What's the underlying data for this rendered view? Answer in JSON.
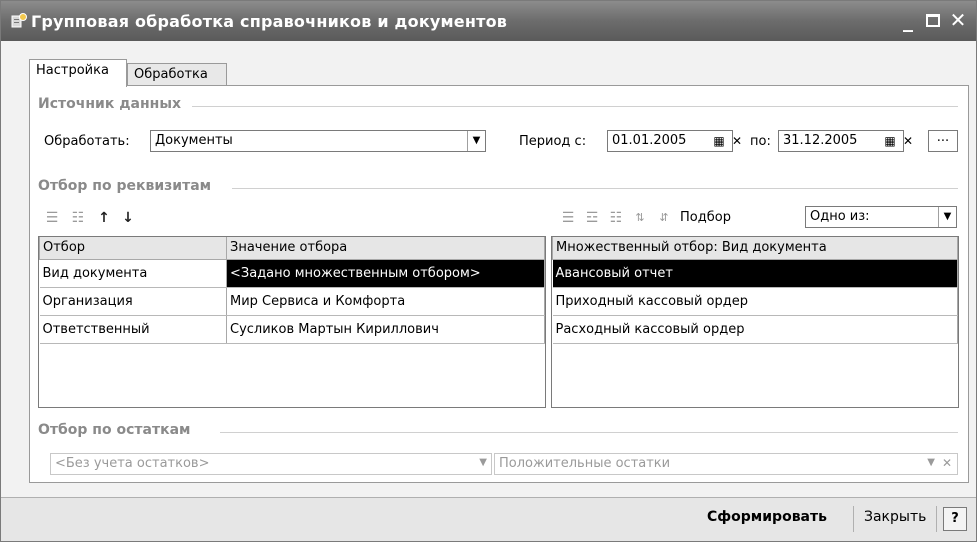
{
  "window": {
    "title": "Групповая обработка справочников и документов",
    "minimize": "_",
    "close": "✕"
  },
  "tabs": [
    {
      "label": "Настройка",
      "active": true
    },
    {
      "label": "Обработка",
      "active": false
    }
  ],
  "source": {
    "section_title": "Источник данных",
    "process_label": "Обработать:",
    "process_value": "Документы",
    "period_from_label": "Период с:",
    "period_from": "01.01.2005",
    "period_to_label": "по:",
    "period_to": "31.12.2005",
    "ellipsis": "..."
  },
  "filter": {
    "section_title": "Отбор по реквизитам",
    "left_toolbar_icons": [
      "add-row-icon",
      "delete-row-icon",
      "move-up-icon",
      "move-down-icon"
    ],
    "right_toolbar_icons": [
      "add-row-icon",
      "copy-row-icon",
      "delete-row-icon",
      "sort-asc-icon",
      "sort-desc-icon"
    ],
    "pick_label": "Подбор",
    "pick_mode": "Одно из:",
    "columns": [
      "Отбор",
      "Значение отбора"
    ],
    "rows": [
      {
        "name": "Вид документа",
        "value": "<Задано множественным отбором>",
        "selected": true
      },
      {
        "name": "Организация",
        "value": "Мир Сервиса и Комфорта",
        "selected": false
      },
      {
        "name": "Ответственный",
        "value": "Сусликов Мартын Кириллович",
        "selected": false
      }
    ],
    "multi_header": "Множественный отбор: Вид документа",
    "multi_rows": [
      {
        "value": "Авансовый отчет",
        "selected": true
      },
      {
        "value": "Приходный кассовый ордер",
        "selected": false
      },
      {
        "value": "Расходный кассовый ордер",
        "selected": false
      }
    ]
  },
  "balances": {
    "section_title": "Отбор по остаткам",
    "mode": "<Без учета остатков>",
    "type": "Положительные остатки"
  },
  "footer": {
    "generate_label": "Сформировать",
    "close_label": "Закрыть",
    "help_label": "?"
  }
}
